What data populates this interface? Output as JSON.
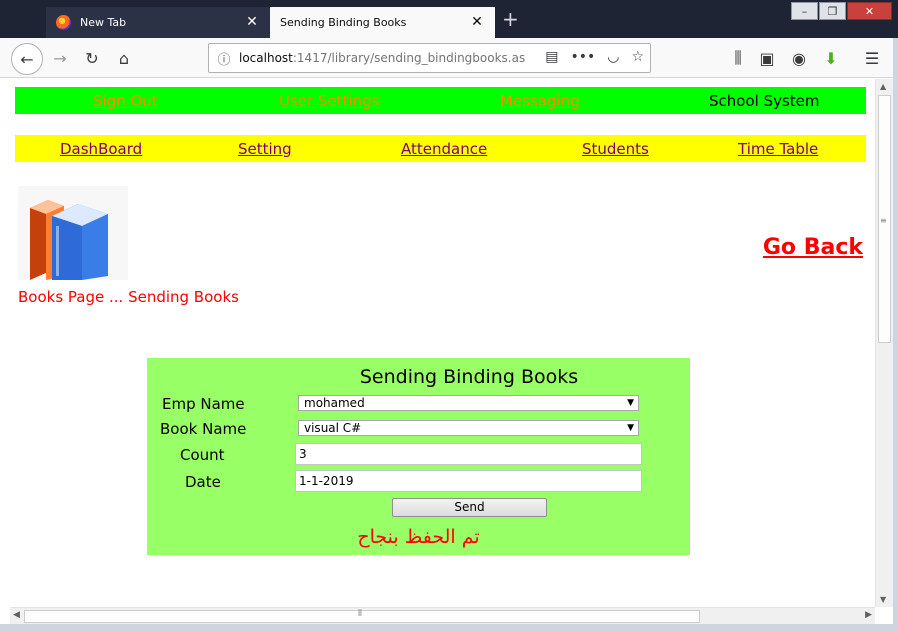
{
  "browser": {
    "tabs": [
      {
        "label": "New Tab"
      },
      {
        "label": "Sending Binding Books"
      }
    ],
    "url_host": "localhost",
    "url_path": ":1417/library/sending_bindingbooks.as"
  },
  "topnav": {
    "sign_out": "Sign Out",
    "user_settings": "User Settings",
    "messaging": "Messaging",
    "brand": "School System"
  },
  "menu": {
    "dashboard": "DashBoard",
    "setting": "Setting",
    "attendance": "Attendance",
    "students": "Students",
    "timetable": "Time Table"
  },
  "page": {
    "caption": "Books Page ... Sending Books",
    "go_back": "Go Back"
  },
  "form": {
    "title": "Sending Binding Books",
    "emp_label": "Emp Name",
    "emp_value": "mohamed",
    "book_label": "Book Name",
    "book_value": "visual C#",
    "count_label": "Count",
    "count_value": "3",
    "date_label": "Date",
    "date_value": "1-1-2019",
    "send_label": "Send",
    "status": "تم الحفظ بنجاح"
  },
  "colors": {
    "topbar": "#00ff00",
    "menubar": "#ffff00",
    "panel": "#99ff66",
    "alert": "#ff0000"
  }
}
